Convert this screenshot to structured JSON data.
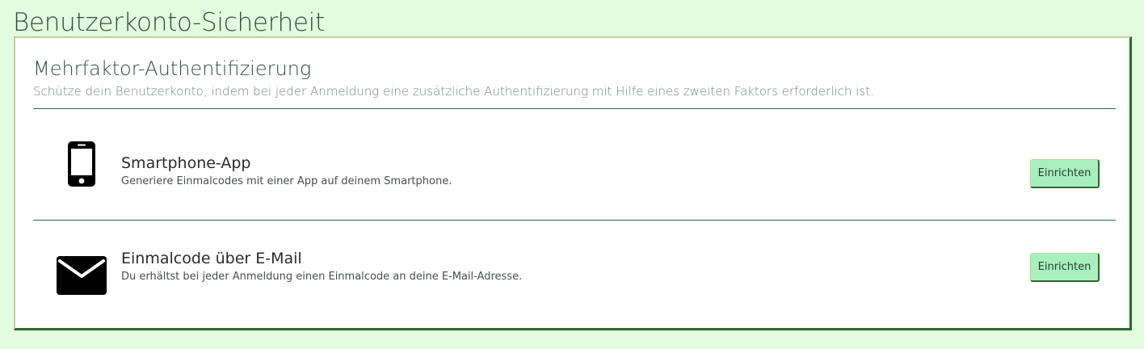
{
  "page": {
    "title": "Benutzerkonto-Sicherheit"
  },
  "mfa": {
    "title": "Mehrfaktor-Authentifizierung",
    "description": "Schütze dein Benutzerkonto, indem bei jeder Anmeldung eine zusätzliche Authentifizierung mit Hilfe eines zweiten Faktors erforderlich ist.",
    "methods": [
      {
        "icon": "smartphone-icon",
        "name": "Smartphone-App",
        "description": "Generiere Einmalcodes mit einer App auf deinem Smartphone.",
        "button_label": "Einrichten"
      },
      {
        "icon": "envelope-icon",
        "name": "Einmalcode über E-Mail",
        "description": "Du erhältst bei jeder Anmeldung einen Einmalcode an deine E-Mail-Adresse.",
        "button_label": "Einrichten"
      }
    ]
  },
  "colors": {
    "page_background": "#e3fce0",
    "card_background": "#ffffff",
    "button_background": "#a7f0be",
    "divider": "#2f6b3a",
    "border_dark": "#2a6b2a",
    "border_light": "#b9d39a"
  }
}
